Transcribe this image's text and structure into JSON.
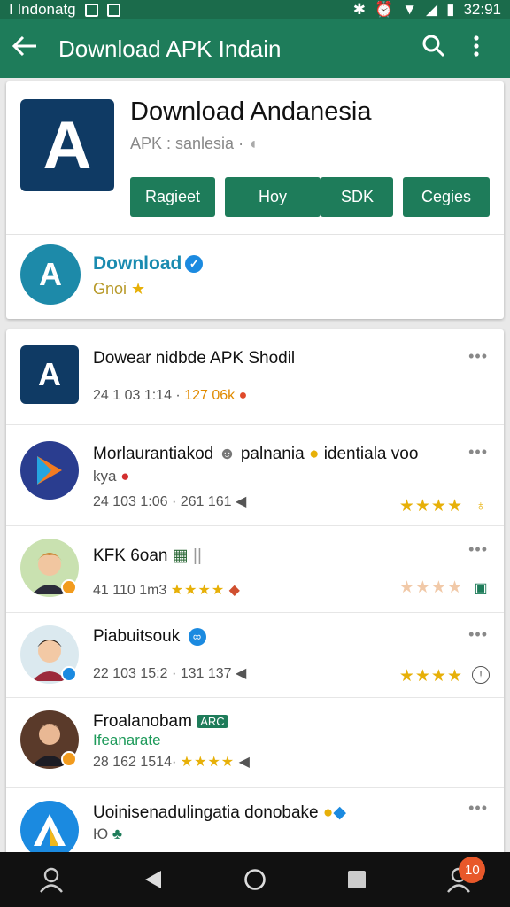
{
  "status": {
    "carrier": "I Indonatg",
    "time": "32:91"
  },
  "appbar": {
    "title": "Download APK Indain"
  },
  "app": {
    "title": "Download Andanesia",
    "subtitle": "APK : sanlesia ·",
    "buttons": [
      "Ragieet",
      "Hoy",
      "SDK",
      "Cegies"
    ]
  },
  "developer": {
    "logo_letter": "A",
    "name": "Download",
    "sub": "Gnoi"
  },
  "list": [
    {
      "name": "Dowear nidbde APK Shodil",
      "meta": "24 1 03 1:14 · ",
      "meta_hl": "127 06k"
    },
    {
      "name": "Morlaurantiakod",
      "name2": "palnania",
      "name3": "identiala voo",
      "line2": "kya",
      "meta": "24 103 1:06 · 261 161",
      "stars": "★★★★"
    },
    {
      "name": "KFK 6oan",
      "meta": "41 110 1m3",
      "meta_stars": "★★★★",
      "stars": "★★★★"
    },
    {
      "name": "Piabuitsouk",
      "meta": "22 103 15:2 · 131 137",
      "stars": "★★★★"
    },
    {
      "name": "Froalanobam",
      "tag": "ARC",
      "line2": "Ifeanarate",
      "meta": "28 162 1514·",
      "meta_stars": "★★★★"
    },
    {
      "name": "Uoinisenadulingatia donobake",
      "line2": "Ю"
    }
  ],
  "nav": {
    "notif_count": "10"
  },
  "colors": {
    "primary": "#1e7c5a",
    "status": "#1b6b4b",
    "app_logo": "#0f3a64",
    "star": "#e7b008"
  }
}
